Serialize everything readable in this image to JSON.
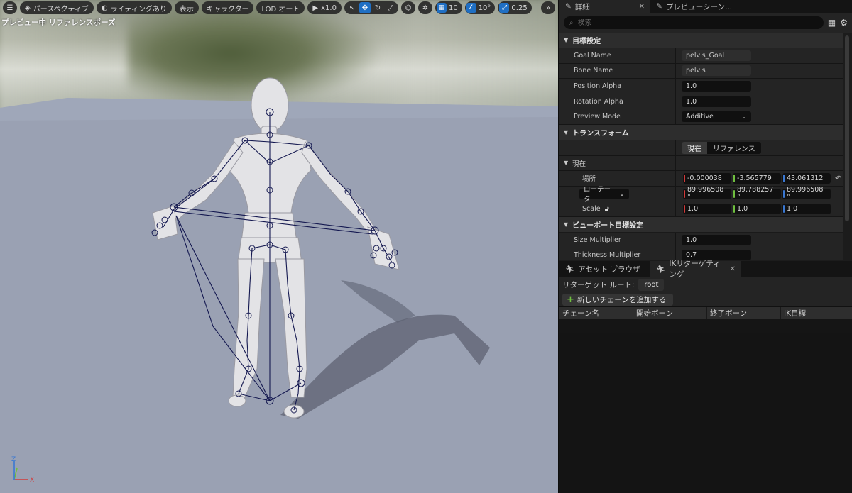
{
  "viewport": {
    "toolbar": {
      "menu_icon": "hamburger-icon",
      "perspective": "パースペクティブ",
      "lighting": "ライティングあり",
      "show": "表示",
      "character": "キャラクター",
      "lod": "LOD オート",
      "play_speed": "x1.0",
      "grid_snap": "10",
      "rotation_snap": "10°",
      "scale_snap": "0.25"
    },
    "overlay_label": "プレビュー中 リファレンスポーズ",
    "axis": {
      "x": "X",
      "y": "Y",
      "z": "Z"
    }
  },
  "details_panel": {
    "tabs": [
      {
        "label": "詳細",
        "icon": "pencil-icon"
      },
      {
        "label": "プレビューシーン..."
      }
    ],
    "search_placeholder": "検索",
    "sections": {
      "goal": {
        "title": "目標設定",
        "goal_name_label": "Goal Name",
        "goal_name_value": "pelvis_Goal",
        "bone_name_label": "Bone Name",
        "bone_name_value": "pelvis",
        "position_alpha_label": "Position Alpha",
        "position_alpha_value": "1.0",
        "rotation_alpha_label": "Rotation Alpha",
        "rotation_alpha_value": "1.0",
        "preview_mode_label": "Preview Mode",
        "preview_mode_value": "Additive"
      },
      "transform": {
        "title": "トランスフォーム",
        "mode_current": "現在",
        "mode_reference": "リファレンス",
        "current_group": "現在",
        "location_label": "場所",
        "location": [
          "-0.000038",
          "-3.565779",
          "43.061312"
        ],
        "rotation_label": "ローテータ",
        "rotation": [
          "89.996508 °",
          "89.788257 °",
          "89.996508 °"
        ],
        "scale_label": "Scale",
        "scale": [
          "1.0",
          "1.0",
          "1.0"
        ]
      },
      "viewport_goal": {
        "title": "ビューポート目標設定",
        "size_multiplier_label": "Size Multiplier",
        "size_multiplier_value": "1.0",
        "thickness_multiplier_label": "Thickness Multiplier",
        "thickness_multiplier_value": "0.7"
      }
    }
  },
  "bottom_panel": {
    "tabs": [
      {
        "label": "アセット ブラウザ"
      },
      {
        "label": "IKリターゲティング"
      }
    ],
    "retarget_root_label": "リターゲット ルート:",
    "retarget_root_value": "root",
    "add_chain_button": "新しいチェーンを追加する",
    "columns": [
      "チェーン名",
      "開始ボーン",
      "終了ボーン",
      "IK目標"
    ]
  },
  "colors": {
    "accent": "#1f6fc4",
    "x_axis": "#d23a3a",
    "y_axis": "#6fbf3f",
    "z_axis": "#3a78d2"
  }
}
